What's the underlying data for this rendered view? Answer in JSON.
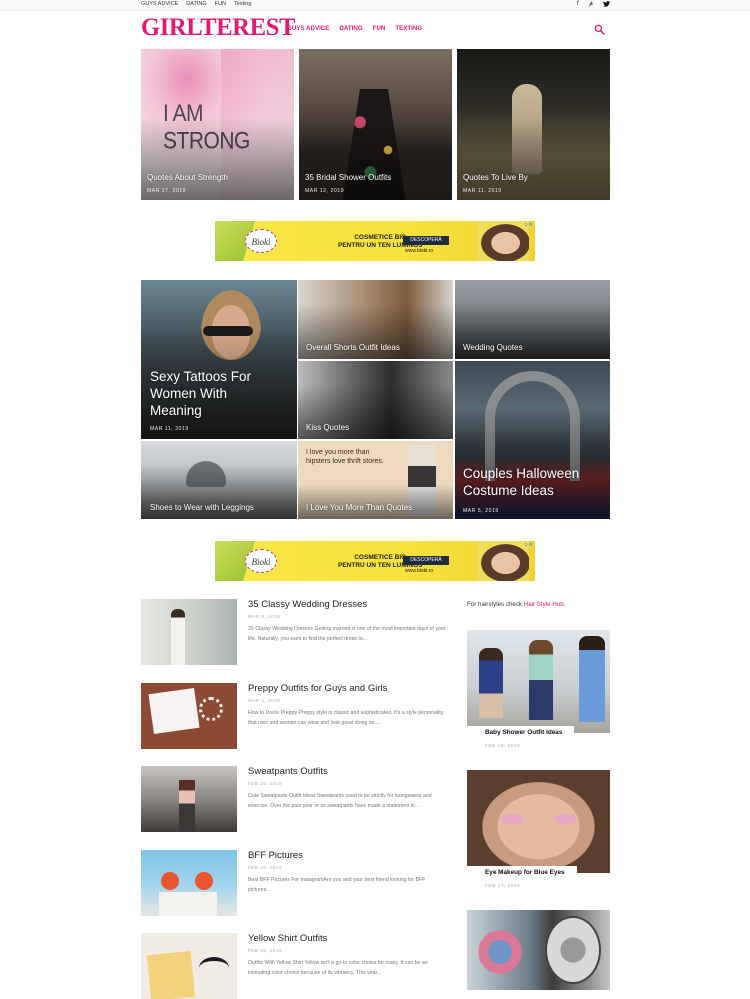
{
  "topbar": {
    "links": [
      "GUYS ADVICE",
      "DATING",
      "FUN",
      "Texting"
    ],
    "social": [
      "facebook-icon",
      "pinterest-icon",
      "twitter-icon"
    ]
  },
  "header": {
    "logo": "GIRLTEREST",
    "nav": [
      "GUYS ADVICE",
      "DATING",
      "FUN",
      "TEXTING"
    ],
    "search_icon": "search-icon"
  },
  "colors": {
    "brand": "#e41872",
    "ad_yellow": "#f6e23b"
  },
  "top_posts": [
    {
      "title": "Quotes About Strength",
      "date": "MAR 27, 2019",
      "overlay": "I AM STRONG"
    },
    {
      "title": "35 Bridal Shower Outfits",
      "date": "MAR 12, 2019"
    },
    {
      "title": "Quotes To Live By",
      "date": "MAR 11, 2019"
    }
  ],
  "ad": {
    "brand": "Bioki",
    "headline_1": "COSMETICE BIO",
    "headline_2": "PENTRU UN TEN LUMINOS",
    "button": "DESCOPERĂ",
    "url": "www.bioki.ro",
    "corner": "▷✕"
  },
  "grid_posts": {
    "feature_left": {
      "title": "Sexy Tattoos For Women With Meaning",
      "date": "MAR 11, 2019"
    },
    "feature_right": {
      "title": "Couples Halloween Costume Ideas",
      "date": "MAR 5, 2019"
    },
    "overall": "Overall Shorts Outfit Ideas",
    "wedding_quotes": "Wedding Quotes",
    "kiss": "Kiss Quotes",
    "shoes": "Shoes to Wear with Leggings",
    "love_more": "I Love You More Than Quotes",
    "love_more_image_text": "I love you more than hipsters love thrift stores."
  },
  "list_posts": [
    {
      "title": "35 Classy Wedding Dresses",
      "date": "MAR 5, 2019",
      "excerpt": "35 Classy Wedding Dresses Getting married is one of the most important days of your life. Naturally, you want to find the perfect dress to..."
    },
    {
      "title": "Preppy Outfits for Guys and Girls",
      "date": "MAR 2, 2019",
      "excerpt": "How to Dress Preppy Preppy style is classic and sophisticated. It's a style personality that men and women can wear and look great doing so...."
    },
    {
      "title": "Sweatpants Outfits",
      "date": "FEB 28, 2019",
      "excerpt": "Cute Sweatpants Outfit Ideas Sweatpants used to be strictly for loungewear and exercise. Over the past year or so sweatpants have made a statement in..."
    },
    {
      "title": "BFF Pictures",
      "date": "FEB 26, 2019",
      "excerpt": "Best BFF Pictures For InstagramAre you and your best friend looking for BFF pictures..."
    },
    {
      "title": "Yellow Shirt Outfits",
      "date": "FEB 25, 2019",
      "excerpt": "Outfits With Yellow Shirt Yellow isn't a go-to color choice for many. It can be an intimating color choice because of its vibrancy. This year..."
    }
  ],
  "sidebar": {
    "hint_prefix": "For hairstyles check",
    "hint_link": "Hair Style Hub",
    "hint_suffix": ".",
    "cards": [
      {
        "title": "Baby Shower Outfit Ideas",
        "date": "FEB 19, 2019"
      },
      {
        "title": "Eye Makeup for Blue Eyes",
        "date": "FEB 17, 2019"
      }
    ]
  }
}
